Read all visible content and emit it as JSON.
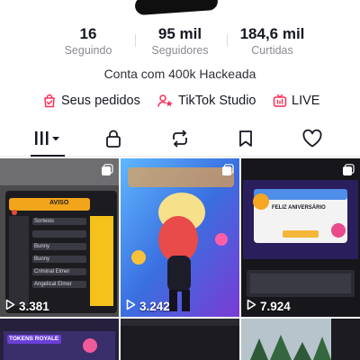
{
  "profile": {
    "bio": "Conta com 400k Hackeada",
    "stats": [
      {
        "value": "16",
        "label": "Seguindo"
      },
      {
        "value": "95 mil",
        "label": "Seguidores"
      },
      {
        "value": "184,6 mil",
        "label": "Curtidas"
      }
    ]
  },
  "links": [
    {
      "label": "Seus pedidos",
      "icon": "bag-check-icon",
      "color": "#fe2c55"
    },
    {
      "label": "TikTok Studio",
      "icon": "person-star-icon",
      "color": "#fe2c55"
    },
    {
      "label": "LIVE",
      "icon": "tv-icon",
      "color": "#fe2c55"
    }
  ],
  "tabs": [
    {
      "name": "videos-grid",
      "icon": "grid-icon",
      "active": true
    },
    {
      "name": "private",
      "icon": "lock-icon"
    },
    {
      "name": "reposts",
      "icon": "repost-icon"
    },
    {
      "name": "favorites",
      "icon": "bookmark-icon"
    },
    {
      "name": "liked",
      "icon": "heart-icon"
    }
  ],
  "videos": [
    {
      "views": "3.381",
      "multi": true,
      "thumb": "dashboard",
      "overlay_text": [
        "AVISO",
        "Sorteios",
        "Bunny",
        "Bunny",
        "Criminal Elmer",
        "Angelical Elmer"
      ]
    },
    {
      "views": "3.242",
      "multi": true,
      "thumb": "character"
    },
    {
      "views": "7.924",
      "multi": true,
      "thumb": "desktop",
      "overlay_text": [
        "FELIZ ANIVERSÁRIO"
      ]
    },
    {
      "views": "",
      "multi": false,
      "thumb": "token",
      "overlay_text": [
        "TOKENS ROYALE"
      ]
    },
    {
      "views": "",
      "multi": false,
      "thumb": "dark"
    },
    {
      "views": "",
      "multi": false,
      "thumb": "forest"
    }
  ],
  "colors": {
    "accent": "#fe2c55",
    "text": "#161823",
    "muted": "#8a8b91"
  }
}
